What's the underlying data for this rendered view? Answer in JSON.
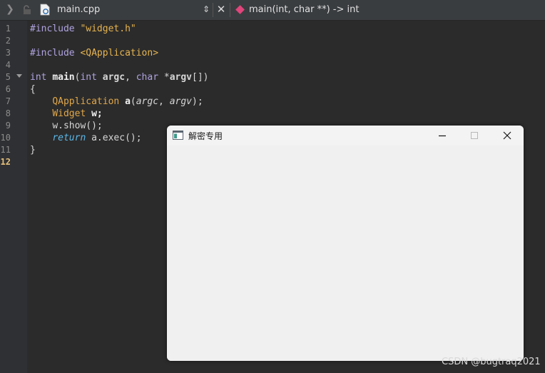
{
  "topbar": {
    "filename": "main.cpp",
    "function_crumb": "main(int, char **) -> int"
  },
  "gutter": {
    "line_numbers": [
      "1",
      "2",
      "3",
      "4",
      "5",
      "6",
      "7",
      "8",
      "9",
      "10",
      "11",
      "12"
    ],
    "current_line": "12"
  },
  "code": {
    "l1_directive": "#include",
    "l1_header": "\"widget.h\"",
    "l3_directive": "#include",
    "l3_header": "<QApplication>",
    "l5_int": "int",
    "l5_main": "main",
    "l5_open": "(",
    "l5_int2": "int",
    "l5_argc": "argc",
    "l5_comma": ", ",
    "l5_char": "char",
    "l5_star": " *",
    "l5_argv": "argv",
    "l5_close": "[])",
    "l6_brace": "{",
    "l7_type": "QApplication",
    "l7_var": "a",
    "l7_open": "(",
    "l7_argc": "argc",
    "l7_comma": ", ",
    "l7_argv": "argv",
    "l7_close": ");",
    "l8_type": "Widget",
    "l8_var": "w;",
    "l9_call": "w.show();",
    "l10_return": "return",
    "l10_expr": " a.exec();",
    "l11_brace": "}"
  },
  "qt_window": {
    "title": "解密专用"
  },
  "watermark": "CSDN @bugtraq2021",
  "colors": {
    "editor_bg": "#2b2b2b",
    "preprocessor": "#b0a3e0",
    "string": "#e6b450",
    "type": "#e0a74a",
    "return_keyword": "#5bb8e8",
    "current_line_number": "#e5c07b",
    "symbol_marker": "#e0457b"
  }
}
